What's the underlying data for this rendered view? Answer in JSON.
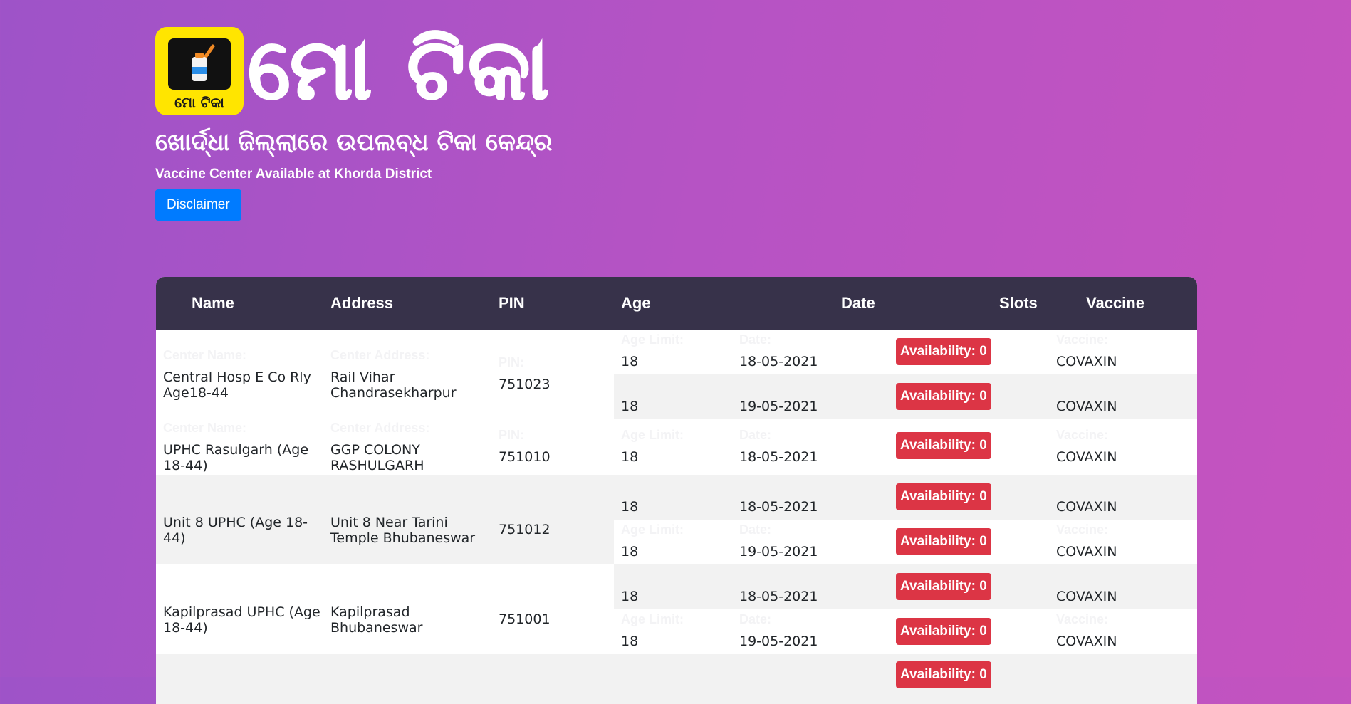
{
  "logo": {
    "caption": "ମୋ ଟିକା",
    "icon": "vaccine-icon"
  },
  "title_odia": "ମୋ ଟିକା",
  "subtitle_odia": "ଖୋର୍ଦ୍ଧା ଜିଲ୍ଲାରେ ଉପଲବ୍ଧ ଟିକା କେନ୍ଦ୍ର",
  "subtitle_en": "Vaccine Center Available at Khorda District",
  "disclaimer_label": "Disclaimer",
  "colors": {
    "header_bg": "#37324a",
    "badge": "#dc3545",
    "button": "#007bff",
    "logo_bg": "#ffe500"
  },
  "table": {
    "headers": {
      "name": "Name",
      "address": "Address",
      "pin": "PIN",
      "age": "Age",
      "date": "Date",
      "slots": "Slots",
      "vaccine": "Vaccine"
    },
    "labels": {
      "name": "Center Name:",
      "address": "Center Address:",
      "pin": "PIN:",
      "age": "Age Limit:",
      "date": "Date:",
      "vaccine": "Vaccine:"
    },
    "centers": [
      {
        "name": "Central Hosp E Co Rly Age18-44",
        "address": "Rail Vihar Chandrasekharpur",
        "pin": "751023",
        "sessions": [
          {
            "age": "18",
            "date": "18-05-2021",
            "availability": "Availability: 0",
            "vaccine": "COVAXIN"
          },
          {
            "age": "18",
            "date": "19-05-2021",
            "availability": "Availability: 0",
            "vaccine": "COVAXIN"
          }
        ]
      },
      {
        "name": "UPHC Rasulgarh (Age 18-44)",
        "address": "GGP COLONY RASHULGARH",
        "pin": "751010",
        "sessions": [
          {
            "age": "18",
            "date": "18-05-2021",
            "availability": "Availability: 0",
            "vaccine": "COVAXIN"
          }
        ]
      },
      {
        "name": "Unit 8 UPHC (Age 18-44)",
        "address": "Unit 8 Near Tarini Temple Bhubaneswar",
        "pin": "751012",
        "sessions": [
          {
            "age": "18",
            "date": "18-05-2021",
            "availability": "Availability: 0",
            "vaccine": "COVAXIN"
          },
          {
            "age": "18",
            "date": "19-05-2021",
            "availability": "Availability: 0",
            "vaccine": "COVAXIN"
          }
        ]
      },
      {
        "name": "Kapilprasad UPHC (Age 18-44)",
        "address": "Kapilprasad Bhubaneswar",
        "pin": "751001",
        "sessions": [
          {
            "age": "18",
            "date": "18-05-2021",
            "availability": "Availability: 0",
            "vaccine": "COVAXIN"
          },
          {
            "age": "18",
            "date": "19-05-2021",
            "availability": "Availability: 0",
            "vaccine": "COVAXIN"
          }
        ]
      },
      {
        "sessions": [
          {
            "availability": "Availability: 0"
          }
        ]
      }
    ]
  }
}
